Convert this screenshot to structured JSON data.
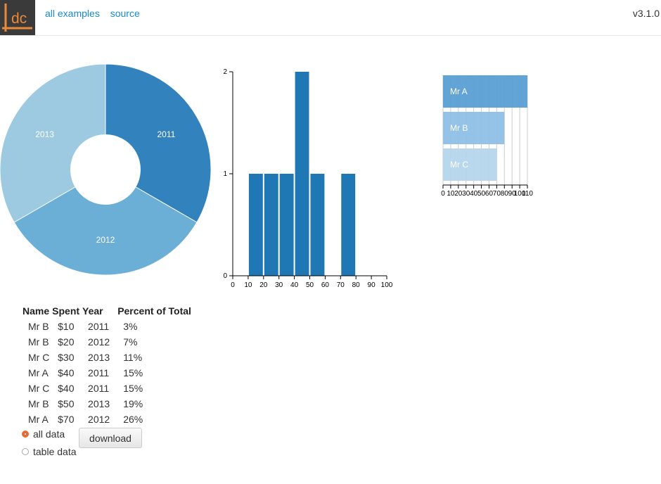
{
  "header": {
    "nav_all_examples": "all examples",
    "nav_source": "source",
    "version": "v3.1.0",
    "logo_text": "dc"
  },
  "colors": {
    "accent": "#1a8acb",
    "logo_bg": "#3a3a3a",
    "logo_orange": "#e8893c",
    "slice_2011": "#3182bd",
    "slice_2012": "#6baed6",
    "slice_2013": "#9ecae1",
    "bar_fill": "#1f77b4",
    "row_a": "#5a9fd4",
    "row_b": "#8ec0e6",
    "row_c": "#b5d5ec"
  },
  "chart_data": [
    {
      "type": "pie",
      "labels": [
        "2011",
        "2012",
        "2013"
      ],
      "values": [
        3,
        3,
        3
      ],
      "inner_radius_ratio": 0.33
    },
    {
      "type": "bar",
      "x": [
        10,
        20,
        30,
        40,
        50,
        70
      ],
      "values": [
        1,
        1,
        1,
        2,
        1,
        1
      ],
      "xlim": [
        0,
        100
      ],
      "ylim": [
        0,
        2
      ],
      "x_ticks": [
        "0",
        "10",
        "20",
        "30",
        "40",
        "50",
        "60",
        "70",
        "80",
        "90",
        "100"
      ],
      "y_ticks": [
        "0",
        "1",
        "2"
      ]
    },
    {
      "type": "bar",
      "orientation": "horizontal",
      "categories": [
        "Mr A",
        "Mr B",
        "Mr C"
      ],
      "values": [
        110,
        80,
        70
      ],
      "xlim": [
        0,
        110
      ],
      "x_ticks": [
        "0",
        "10",
        "20",
        "30",
        "40",
        "50",
        "60",
        "70",
        "80",
        "90",
        "100",
        "110"
      ]
    }
  ],
  "table": {
    "headers": [
      "Name",
      "Spent",
      "Year",
      "Percent of Total"
    ],
    "rows": [
      [
        "Mr B",
        "$10",
        "2011",
        "3%"
      ],
      [
        "Mr B",
        "$20",
        "2012",
        "7%"
      ],
      [
        "Mr C",
        "$30",
        "2013",
        "11%"
      ],
      [
        "Mr A",
        "$40",
        "2011",
        "15%"
      ],
      [
        "Mr C",
        "$40",
        "2011",
        "15%"
      ],
      [
        "Mr B",
        "$50",
        "2013",
        "19%"
      ],
      [
        "Mr A",
        "$70",
        "2012",
        "26%"
      ]
    ]
  },
  "controls": {
    "radio_all": "all data",
    "radio_table": "table data",
    "selected": "all data",
    "download": "download"
  }
}
